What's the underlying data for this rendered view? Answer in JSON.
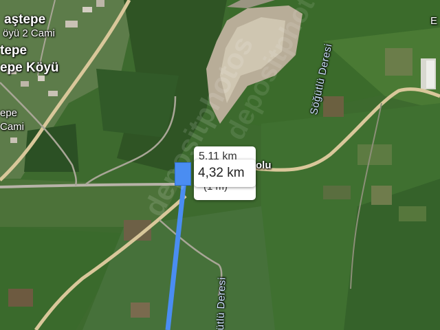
{
  "map": {
    "type": "satellite",
    "labels": {
      "village_top_partial": "aştepe",
      "mosque_top": "öyü 2 Cami",
      "village_left": "tepe",
      "village_left_line2": "epe Köyü",
      "mosque_left_line1": "epe",
      "mosque_left_line2": "Cami",
      "stream_top": "Söğütlü Deresi",
      "stream_bottom": "ütlü Deresi",
      "road_name_partial": "olu",
      "edge_letter": "E"
    },
    "watermark": "depositphotos"
  },
  "measurement": {
    "distance_front": "4,32 km",
    "distance_back_top": "5,11 km",
    "distance_back_bottom": "(1 m)"
  },
  "colors": {
    "route_line": "#4a8df2",
    "road": "#d9c79a",
    "stream": "#cfe3ff"
  }
}
